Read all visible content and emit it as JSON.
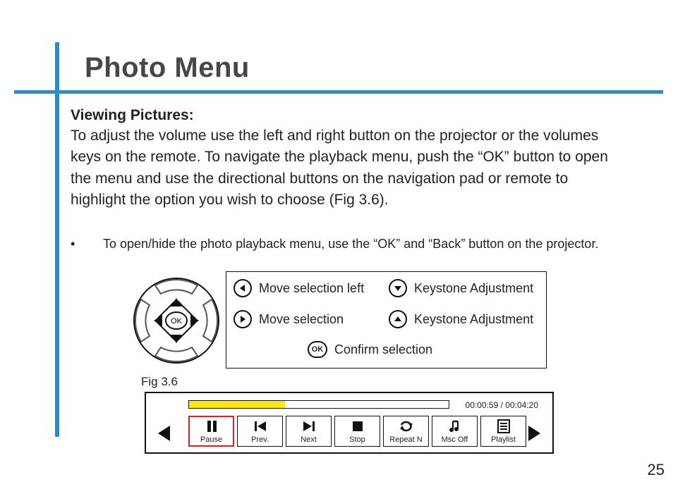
{
  "title": "Photo Menu",
  "section_heading": "Viewing Pictures:",
  "section_body": "To adjust the volume use the left and right button on the projector or the volumes keys on the remote. To navigate the playback menu, push the “OK” button to open the menu and use the directional buttons on the navigation pad or remote to highlight the option you wish to choose (Fig 3.6).",
  "bullet": "To open/hide the photo playback menu, use the “OK” and “Back” button on the projector.",
  "legend": {
    "left": "Move selection left",
    "right": "Move selection",
    "down": "Keystone Adjustment",
    "up": "Keystone Adjustment",
    "ok": "Confirm selection",
    "ok_label": "OK"
  },
  "figure_label": "Fig  3.6",
  "navpad_ok": "OK",
  "player": {
    "elapsed": "00:00:59",
    "total": "00:04:20",
    "progress_pct": 37,
    "buttons": [
      {
        "id": "pause",
        "label": "Pause",
        "selected": true
      },
      {
        "id": "prev",
        "label": "Prev."
      },
      {
        "id": "next",
        "label": "Next"
      },
      {
        "id": "stop",
        "label": "Stop"
      },
      {
        "id": "repeat",
        "label": "Repeat N"
      },
      {
        "id": "music",
        "label": "Msc Off"
      },
      {
        "id": "playlist",
        "label": "Playlist"
      }
    ]
  },
  "page_number": "25"
}
